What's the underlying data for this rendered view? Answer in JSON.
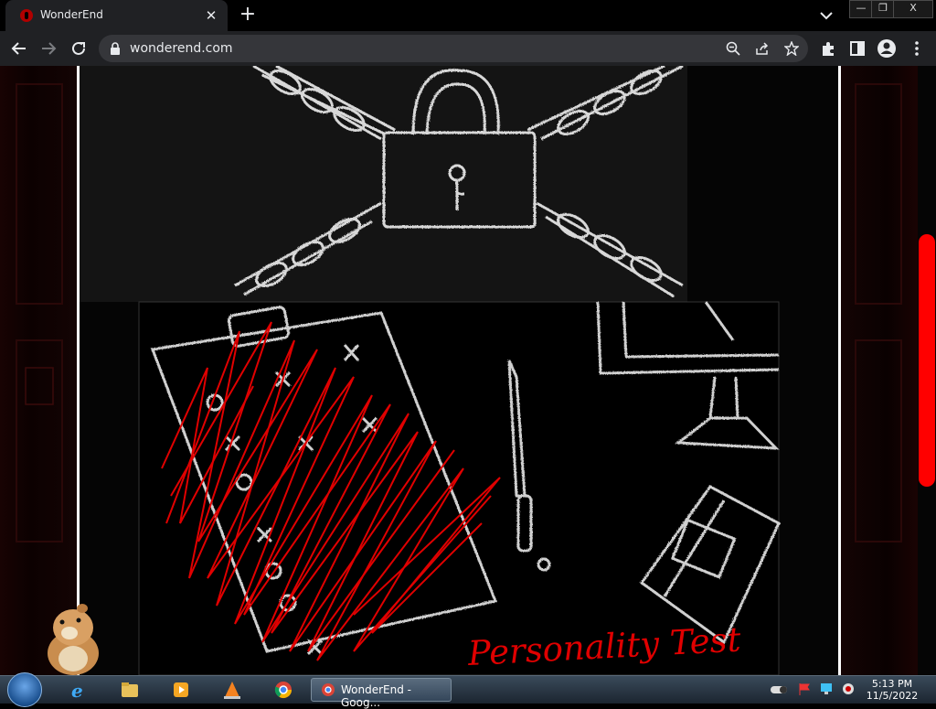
{
  "browser": {
    "tab_title": "WonderEnd",
    "tab_close": "✕",
    "new_tab": "+",
    "url": "wonderend.com"
  },
  "window_controls": {
    "minimize": "—",
    "restore": "❐",
    "close": "X"
  },
  "page": {
    "illustration_text": "Personality Test",
    "scroll_position_fraction": 0.32,
    "accent_color": "#ff0000"
  },
  "taskbar": {
    "active_window_label": "WonderEnd - Goog...",
    "time": "5:13 PM",
    "date": "11/5/2022"
  },
  "icons": [
    "wonderend-favicon",
    "tab-search-icon",
    "back-icon",
    "forward-icon",
    "reload-icon",
    "lock-icon",
    "zoom-icon",
    "share-icon",
    "star-icon",
    "extensions-icon",
    "side-panel-icon",
    "profile-icon",
    "menu-icon",
    "start-orb-icon",
    "ie-icon",
    "explorer-icon",
    "media-player-icon",
    "vlc-icon",
    "chrome-icon",
    "hamster-sticker"
  ]
}
